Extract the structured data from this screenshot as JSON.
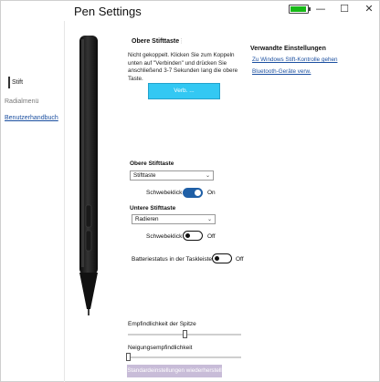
{
  "window": {
    "title": "Pen Settings",
    "battery_level": 0.85,
    "battery_color": "#17b917",
    "minimize_glyph": "—",
    "maximize_glyph": "☐",
    "close_glyph": "✕"
  },
  "sidebar": {
    "items": [
      {
        "label": "Stift"
      },
      {
        "label": "Radialmenü"
      },
      {
        "label": "Benutzerhandbuch"
      }
    ]
  },
  "top_button": {
    "title": "Obere Stifttaste",
    "info_icon": "info-dots-icon",
    "description": "Nicht gekoppelt. Klicken Sie zum Koppeln unten auf \"Verbinden\" und drücken Sie anschließend 3-7 Sekunden lang die obere Taste.",
    "connect_label": "Verb. ..."
  },
  "related": {
    "title": "Verwandte Einstellungen",
    "links": [
      "Zu Windows Stift-Kontrolle gehen",
      "Bluetooth-Geräte verw."
    ]
  },
  "upper_button": {
    "label": "Obere Stifttaste",
    "select_value": "Stifttaste",
    "hover_label": "Schwebeklick",
    "hover_state": "On"
  },
  "lower_button": {
    "label": "Untere Stifttaste",
    "select_value": "Radieren",
    "hover_label": "Schwebeklick",
    "hover_state": "Off"
  },
  "battery_status": {
    "label": "Batteriestatus in der Taskleiste",
    "state": "Off"
  },
  "sensitivity": {
    "tip_label": "Empfindlichkeit der Spitze",
    "tip_value": 0.5,
    "tilt_label": "Neigungsempfindlichkeit",
    "tilt_value": 0.0
  },
  "reset_label": "Standardeinstellungen wiederherstell",
  "colors": {
    "accent": "#1f5fa6",
    "connect_button": "#33c8f3",
    "link": "#1b4fa0"
  }
}
